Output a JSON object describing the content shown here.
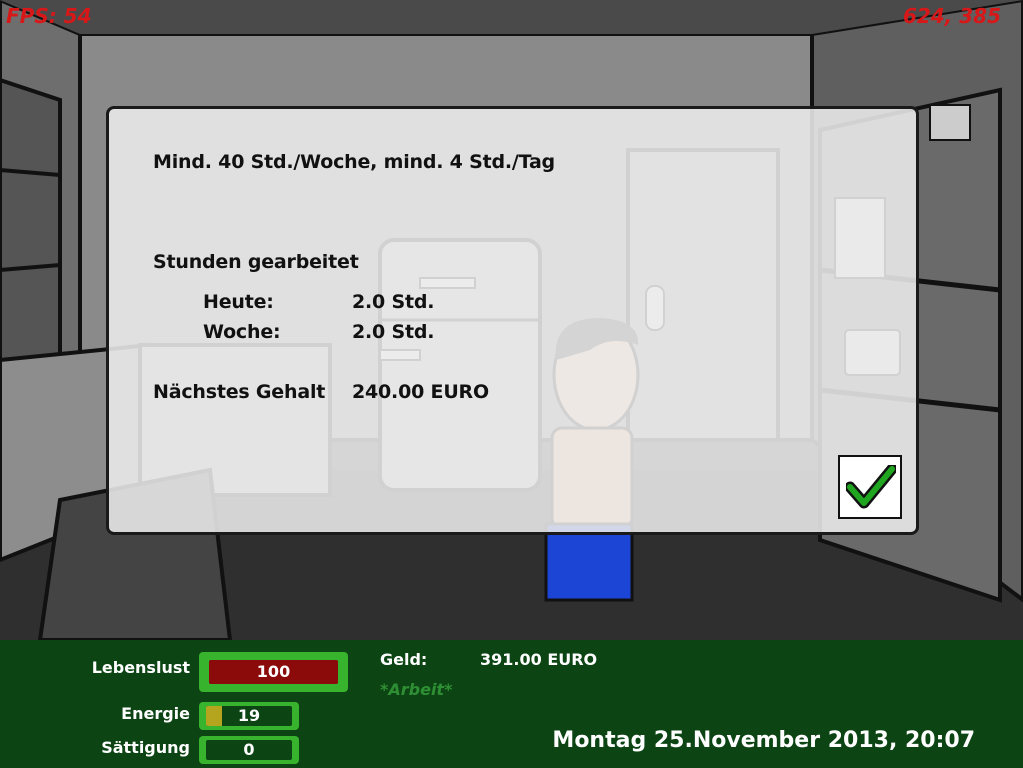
{
  "hud": {
    "fps": "FPS: 54",
    "cursor": "624, 385"
  },
  "dialog": {
    "requirement": "Mind. 40 Std./Woche, mind. 4 Std./Tag",
    "hours_title": "Stunden gearbeitet",
    "today_label": "Heute:",
    "today_value": "2.0 Std.",
    "week_label": "Woche:",
    "week_value": "2.0 Std.",
    "salary_label": "Nächstes Gehalt",
    "salary_value": "240.00 EURO",
    "ok_icon": "green-checkmark-icon"
  },
  "status": {
    "lebenslust_label": "Lebenslust",
    "lebenslust_value": "100",
    "lebenslust_fraction": 1.0,
    "lebenslust_color": "#8b0a0a",
    "energie_label": "Energie",
    "energie_value": "19",
    "energie_fraction": 0.19,
    "energie_color": "#b5a41e",
    "saettigung_label": "Sättigung",
    "saettigung_value": "0",
    "saettigung_fraction": 0.0,
    "geld_label": "Geld:",
    "geld_value": "391.00 EURO",
    "activity": "*Arbeit*",
    "datetime": "Montag 25.November 2013, 20:07"
  },
  "colors": {
    "statusbar_bg": "#0c4513",
    "bar_border": "#37b32e",
    "hud_text": "#d81818"
  }
}
